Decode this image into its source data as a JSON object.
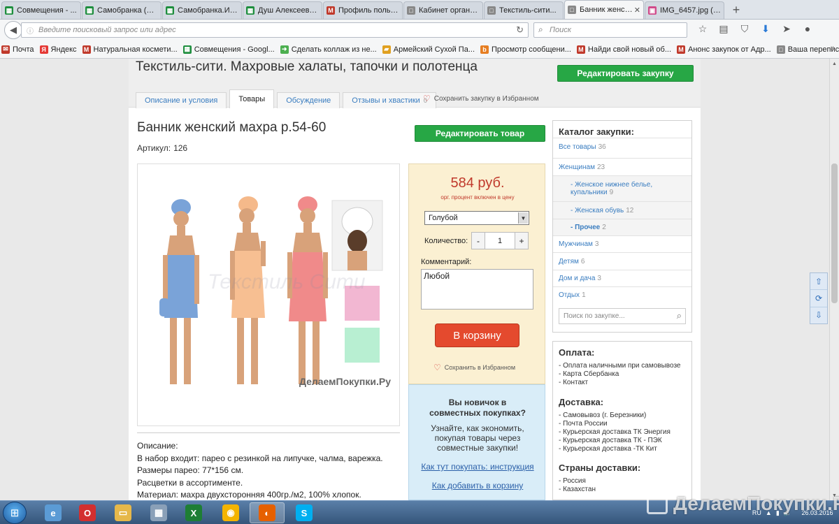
{
  "browser": {
    "tabs": [
      {
        "title": "Совмещения - ...",
        "icon": "sheets-icon",
        "color": "#1e8e3e",
        "active": false
      },
      {
        "title": "Самобранка (ад...",
        "icon": "sheets-icon",
        "color": "#1e8e3e",
        "active": false
      },
      {
        "title": "Самобранка.ИК...",
        "icon": "sheets-icon",
        "color": "#1e8e3e",
        "active": false
      },
      {
        "title": "Душ Алексеева...",
        "icon": "sheets-icon",
        "color": "#1e8e3e",
        "active": false
      },
      {
        "title": "Профиль польз...",
        "icon": "m-icon",
        "color": "#c0392b",
        "active": false
      },
      {
        "title": "Кабинет органи...",
        "icon": "page-icon",
        "color": "#888888",
        "active": false
      },
      {
        "title": "Текстиль-сити...",
        "icon": "page-icon",
        "color": "#888888",
        "active": false
      },
      {
        "title": "Банник женск...",
        "icon": "page-icon",
        "color": "#888888",
        "active": true
      },
      {
        "title": "IMG_6457.jpg (И...",
        "icon": "image-icon",
        "color": "#d04a8a",
        "active": false
      }
    ],
    "url_placeholder": "Введите поисковый запрос или адрес",
    "search_placeholder": "Поиск",
    "bookmarks": [
      {
        "label": "Почта",
        "icon": "mail-icon",
        "color": "#c0392b"
      },
      {
        "label": "Яндекс",
        "icon": "yandex-icon",
        "color": "#e53935"
      },
      {
        "label": "Натуральная космети...",
        "icon": "m-icon",
        "color": "#c0392b"
      },
      {
        "label": "Совмещения - Googl...",
        "icon": "sheets-icon",
        "color": "#1e8e3e"
      },
      {
        "label": "Сделать коллаж из не...",
        "icon": "arrow-icon",
        "color": "#4caf50"
      },
      {
        "label": "Армейский Сухой Па...",
        "icon": "bag-icon",
        "color": "#e0a020"
      },
      {
        "label": "Просмотр сообщени...",
        "icon": "b-icon",
        "color": "#e67e22"
      },
      {
        "label": "Найди свой новый об...",
        "icon": "m-icon",
        "color": "#c0392b"
      },
      {
        "label": "Анонс закупок от Адр...",
        "icon": "m-icon",
        "color": "#c0392b"
      },
      {
        "label": "Ваша переписка с Ste...",
        "icon": "page-icon",
        "color": "#888888"
      }
    ]
  },
  "page": {
    "purchase_title": "Текстиль-сити. Махровые халаты, тапочки и полотенца",
    "edit_purchase": "Редактировать закупку",
    "tabs": [
      {
        "label": "Описание и условия",
        "active": false
      },
      {
        "label": "Товары",
        "active": true
      },
      {
        "label": "Обсуждение",
        "active": false
      },
      {
        "label": "Отзывы и хвастики",
        "count": "0",
        "active": false
      }
    ],
    "save_favorite": "Сохранить закупку в Избранном",
    "product_title": "Банник женский махра р.54-60",
    "article_label": "Артикул:",
    "article_value": "126",
    "edit_product": "Редактировать товар",
    "photo_watermark_center": "Текстиль Сити",
    "photo_watermark_site": "ДелаемПокупки.Ру",
    "price": "584 руб.",
    "price_note": "орг. процент включен в цену",
    "color_value": "Голубой",
    "quantity_label": "Количество:",
    "quantity_minus": "-",
    "quantity_value": "1",
    "quantity_plus": "+",
    "comment_label": "Комментарий:",
    "comment_value": "Любой",
    "cart_button": "В корзину",
    "save_favorite_item": "Сохранить в Избранном",
    "newbie": {
      "title_line1": "Вы новичок в",
      "title_line2": "совместных покупках?",
      "text_line1": "Узнайте, как экономить,",
      "text_line2": "покупая товары через",
      "text_line3": "совместные закупки!",
      "link1": "Как тут покупать: инструкция",
      "link2": "Как добавить в корзину"
    },
    "description": [
      "Описание:",
      "В набор входит: парео с резинкой на липучке, чалма, варежка.",
      "Размеры парео: 77*156 см.",
      "Расцветки в ассортименте.",
      "Материал: махра двухсторонняя 400гр./м2, 100% хлопок."
    ],
    "catalog": {
      "title": "Каталог закупки:",
      "items": [
        {
          "label": "Все товары",
          "count": "36",
          "sub": false,
          "bold": false
        },
        {
          "label": "Женщинам",
          "count": "23",
          "sub": false,
          "bold": false
        },
        {
          "label": "- Женское нижнее белье,",
          "label2": "купальники",
          "count": "9",
          "sub": true,
          "bold": false
        },
        {
          "label": "- Женская обувь",
          "count": "12",
          "sub": true,
          "bold": false
        },
        {
          "label": "- Прочее",
          "count": "2",
          "sub": true,
          "bold": true
        },
        {
          "label": "Мужчинам",
          "count": "3",
          "sub": false,
          "bold": false
        },
        {
          "label": "Детям",
          "count": "6",
          "sub": false,
          "bold": false
        },
        {
          "label": "Дом и дача",
          "count": "3",
          "sub": false,
          "bold": false
        },
        {
          "label": "Отдых",
          "count": "1",
          "sub": false,
          "bold": false
        }
      ],
      "search_placeholder": "Поиск по закупке..."
    },
    "payment": {
      "title": "Оплата:",
      "items": [
        "- Оплата наличными при самовывозе",
        "- Карта Сбербанка",
        "- Контакт"
      ]
    },
    "delivery": {
      "title": "Доставка:",
      "items": [
        "- Самовывоз (г. Березники)",
        "- Почта России",
        "- Курьерская доставка ТК Энергия",
        "- Курьерская доставка ТК - ПЭК",
        "- Курьерская доставка -ТК Кит"
      ]
    },
    "countries": {
      "title": "Страны доставки:",
      "items": [
        "- Россия",
        "- Казахстан"
      ]
    }
  },
  "taskbar": {
    "apps": [
      {
        "name": "start",
        "icon": "windows-icon"
      },
      {
        "name": "explorer",
        "icon": "ie-icon",
        "color": "#5b9bd5"
      },
      {
        "name": "opera",
        "icon": "opera-icon",
        "color": "#d32f2f"
      },
      {
        "name": "folder",
        "icon": "folder-icon",
        "color": "#e6b84a"
      },
      {
        "name": "calculator",
        "icon": "calculator-icon",
        "color": "#8aa0b8"
      },
      {
        "name": "excel",
        "icon": "excel-icon",
        "color": "#1e7e34"
      },
      {
        "name": "chrome",
        "icon": "chrome-icon",
        "color": "#f4b400"
      },
      {
        "name": "firefox",
        "icon": "firefox-icon",
        "color": "#e66000"
      },
      {
        "name": "skype",
        "icon": "skype-icon",
        "color": "#00aff0"
      }
    ],
    "lang": "RU",
    "date": "26.03.2016"
  },
  "watermark": "ДелаемПокупки.Ру"
}
